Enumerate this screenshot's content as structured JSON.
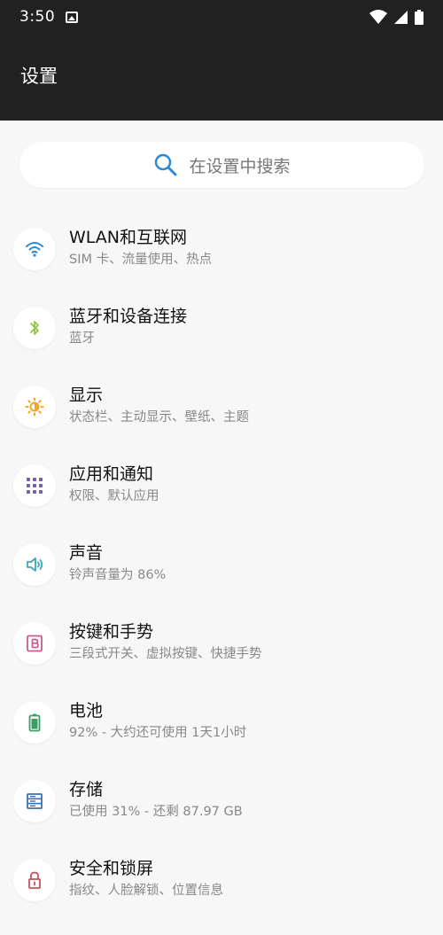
{
  "status_bar": {
    "time": "3:50"
  },
  "header": {
    "title": "设置"
  },
  "search": {
    "placeholder": "在设置中搜索"
  },
  "items": [
    {
      "title": "WLAN和互联网",
      "subtitle": "SIM 卡、流量使用、热点",
      "icon": "wifi-icon",
      "color": "#2b8ad6"
    },
    {
      "title": "蓝牙和设备连接",
      "subtitle": "蓝牙",
      "icon": "bluetooth-icon",
      "color": "#8cc63f"
    },
    {
      "title": "显示",
      "subtitle": "状态栏、主动显示、壁纸、主题",
      "icon": "brightness-icon",
      "color": "#f2a81d"
    },
    {
      "title": "应用和通知",
      "subtitle": "权限、默认应用",
      "icon": "apps-grid-icon",
      "color": "#7b5ea7"
    },
    {
      "title": "声音",
      "subtitle": "铃声音量为 86%",
      "icon": "volume-icon",
      "color": "#3aa8b5"
    },
    {
      "title": "按键和手势",
      "subtitle": "三段式开关、虚拟按键、快捷手势",
      "icon": "button-b-icon",
      "color": "#c85c8e"
    },
    {
      "title": "电池",
      "subtitle": "92% - 大约还可使用 1天1小时",
      "icon": "battery-icon",
      "color": "#3c9d62"
    },
    {
      "title": "存储",
      "subtitle": "已使用 31% - 还剩 87.97 GB",
      "icon": "storage-icon",
      "color": "#3e6fb5"
    },
    {
      "title": "安全和锁屏",
      "subtitle": "指纹、人脸解锁、位置信息",
      "icon": "lock-icon",
      "color": "#c9525a"
    }
  ]
}
